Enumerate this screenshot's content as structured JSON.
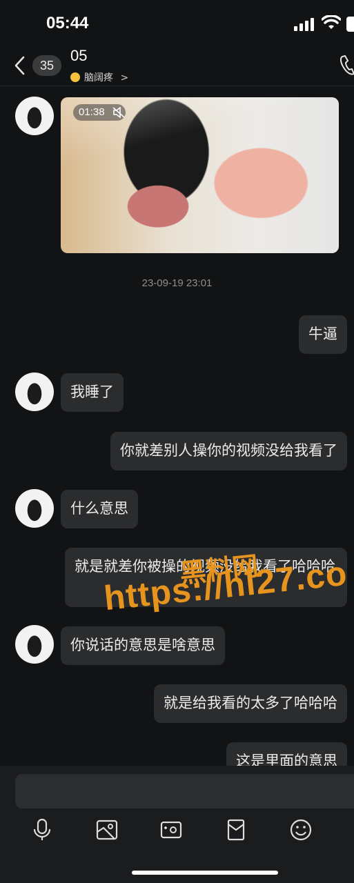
{
  "status": {
    "time": "05:44"
  },
  "header": {
    "back_count": "35",
    "title": "05",
    "subtitle": "脑阔疼"
  },
  "video": {
    "duration": "01:38"
  },
  "timestamp": "23-09-19 23:01",
  "messages": [
    {
      "side": "right",
      "text": "牛逼"
    },
    {
      "side": "left",
      "text": "我睡了"
    },
    {
      "side": "right",
      "text": "你就差别人操你的视频没给我看了"
    },
    {
      "side": "left",
      "text": "什么意思"
    },
    {
      "side": "right",
      "text": "就是就差你被操的视频没给我看了哈哈哈"
    },
    {
      "side": "left",
      "text": "你说话的意思是啥意思"
    },
    {
      "side": "right",
      "text": "就是给我看的太多了哈哈哈"
    },
    {
      "side": "right",
      "text": "这是里面的意思"
    }
  ],
  "watermark": {
    "line1": "黑料网",
    "line2": "https://hl27.co"
  },
  "toolbar": {
    "icons": [
      "microphone-icon",
      "image-icon",
      "camera-icon",
      "red-packet-icon",
      "emoji-icon"
    ]
  }
}
